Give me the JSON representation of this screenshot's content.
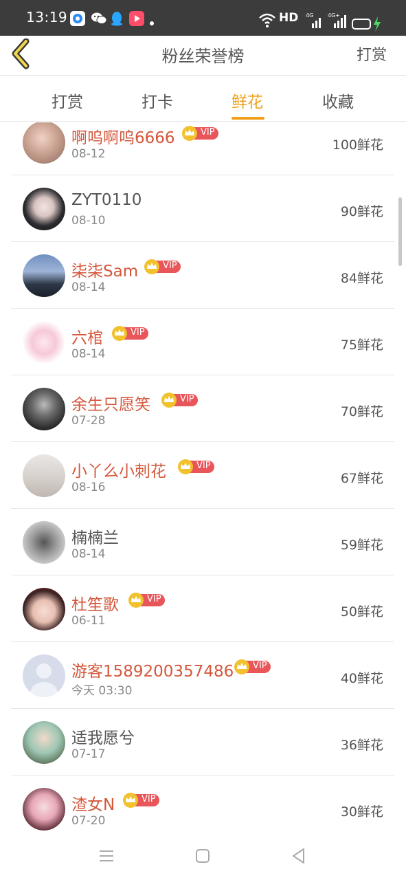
{
  "status_bar": {
    "time": "13:19",
    "network_label": "HD"
  },
  "header": {
    "title": "粉丝荣誉榜",
    "action_label": "打赏"
  },
  "tabs": [
    {
      "label": "打赏"
    },
    {
      "label": "打卡"
    },
    {
      "label": "鲜花",
      "active": true
    },
    {
      "label": "收藏"
    }
  ],
  "badge": {
    "vip_label": "VIP"
  },
  "rankings": [
    {
      "name": "啊呜啊呜6666",
      "vip": true,
      "date": "08-12",
      "count": "100鲜花"
    },
    {
      "name": "ZYT0110",
      "vip": false,
      "date": "08-10",
      "count": "90鲜花"
    },
    {
      "name": "柒柒Sam",
      "vip": true,
      "date": "08-14",
      "count": "84鲜花"
    },
    {
      "name": "六棺",
      "vip": true,
      "date": "08-14",
      "count": "75鲜花"
    },
    {
      "name": "余生只愿笑",
      "vip": true,
      "date": "07-28",
      "count": "70鲜花"
    },
    {
      "name": "小丫么小刺花",
      "vip": true,
      "date": "08-16",
      "count": "67鲜花"
    },
    {
      "name": "楠楠兰",
      "vip": false,
      "date": "08-14",
      "count": "59鲜花"
    },
    {
      "name": "杜笙歌",
      "vip": true,
      "date": "06-11",
      "count": "50鲜花"
    },
    {
      "name": "游客1589200357486",
      "vip": true,
      "date": "今天 03:30",
      "count": "40鲜花"
    },
    {
      "name": "适我愿兮",
      "vip": false,
      "date": "07-17",
      "count": "36鲜花"
    },
    {
      "name": "渣女N",
      "vip": true,
      "date": "07-20",
      "count": "30鲜花"
    }
  ],
  "colors": {
    "accent": "#f0a019",
    "vip_name": "#d4573b",
    "vip_badge": "#e8565a",
    "crown": "#f2c12e"
  }
}
